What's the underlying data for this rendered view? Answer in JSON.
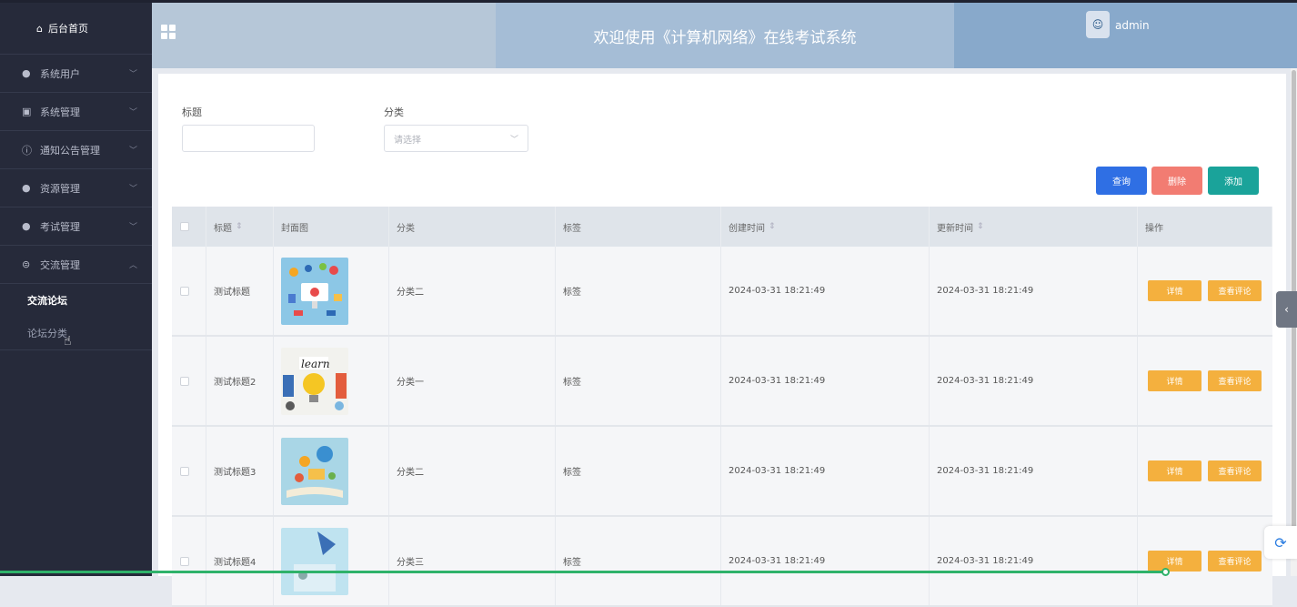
{
  "sidebar": {
    "home": "后台首页",
    "menus": [
      {
        "label": "系统用户",
        "icon": "user-icon"
      },
      {
        "label": "系统管理",
        "icon": "picture-icon"
      },
      {
        "label": "通知公告管理",
        "icon": "info-icon"
      },
      {
        "label": "资源管理",
        "icon": "location-icon"
      },
      {
        "label": "考试管理",
        "icon": "location-icon"
      },
      {
        "label": "交流管理",
        "icon": "chat-icon"
      }
    ],
    "submenu": [
      "交流论坛",
      "论坛分类"
    ]
  },
  "header": {
    "title": "欢迎使用《计算机网络》在线考试系统",
    "user": "admin"
  },
  "filters": {
    "title_label": "标题",
    "title_value": "",
    "category_label": "分类",
    "category_placeholder": "请选择"
  },
  "actions": {
    "query": "查询",
    "delete": "删除",
    "add": "添加",
    "colors": {
      "query": "#2f6fe4",
      "delete": "#f27c72",
      "add": "#1aa39a",
      "op": "#f4b03e"
    }
  },
  "table": {
    "columns": [
      "标题",
      "封面图",
      "分类",
      "标签",
      "创建时间",
      "更新时间",
      "操作"
    ],
    "rows": [
      {
        "title": "测试标题",
        "category": "分类二",
        "tag": "标签",
        "created": "2024-03-31 18:21:49",
        "updated": "2024-03-31 18:21:49"
      },
      {
        "title": "测试标题2",
        "category": "分类一",
        "tag": "标签",
        "created": "2024-03-31 18:21:49",
        "updated": "2024-03-31 18:21:49"
      },
      {
        "title": "测试标题3",
        "category": "分类二",
        "tag": "标签",
        "created": "2024-03-31 18:21:49",
        "updated": "2024-03-31 18:21:49"
      },
      {
        "title": "测试标题4",
        "category": "分类三",
        "tag": "标签",
        "created": "2024-03-31 18:21:49",
        "updated": "2024-03-31 18:21:49"
      }
    ],
    "row_actions": {
      "detail": "详情",
      "comments": "查看评论"
    }
  }
}
